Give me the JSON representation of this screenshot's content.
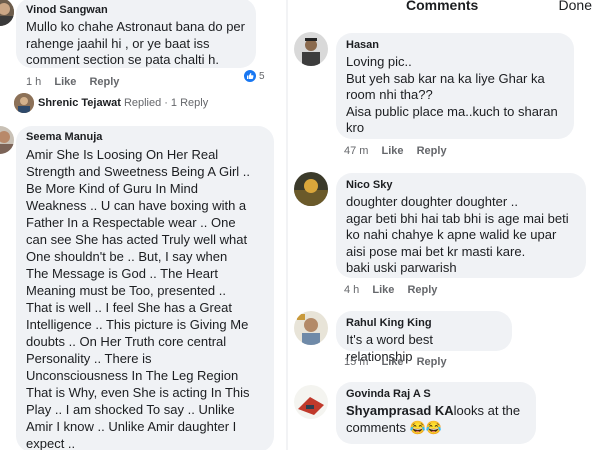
{
  "left": {
    "comments": [
      {
        "author": "Vinod Sangwan",
        "text": "Mullo ko chahe Astronaut bana do per\nrahenge jaahil hi , or ye baat iss\ncomment section se pata chalti h.",
        "time": "1 h",
        "like_label": "Like",
        "reply_label": "Reply",
        "reaction_count": "5",
        "reaction_icon": "like-icon"
      },
      {
        "author": "Seema Manuja",
        "text": "Amir She Is Loosing On Her Real\nStrength and Sweetness Being A Girl ..\nBe More Kind of Guru In Mind\nWeakness .. U can have boxing with a\nFather In a Respectable wear .. One\ncan see She has acted Truly well what\nOne shouldn't be .. But, I say when\nThe Message is God .. The Heart\nMeaning must be Too, presented ..\nThat is well .. I feel She has a Great\nIntelligence .. This picture is Giving Me\ndoubts .. On Her Truth core central\nPersonality .. There is\nUnconsciousness In The Leg Region\nThat is Why, even She is acting In This\nPlay .. I am shocked To say .. Unlike\nAmir I know .. Unlike Amir daughter I\nexpect .."
      }
    ],
    "reply_summary": {
      "name": "Shrenic Tejawat",
      "replied_label": "Replied",
      "separator": "·",
      "count_label": "1 Reply"
    }
  },
  "right": {
    "header": {
      "title": "Comments",
      "done_label": "Done"
    },
    "comments": [
      {
        "author": "Hasan",
        "text": "Loving pic..\nBut yeh sab kar na ka liye Ghar ka\nroom nhi tha??\nAisa public place ma..kuch to sharan\nkro",
        "time": "47 m",
        "like_label": "Like",
        "reply_label": "Reply"
      },
      {
        "author": "Nico Sky",
        "text": "doughter doughter doughter ..\nagar beti bhi hai tab bhi is age mai beti\nko nahi chahye k apne walid ke upar\naisi pose mai bet kr masti kare.\nbaki uski parwarish",
        "time": "4 h",
        "like_label": "Like",
        "reply_label": "Reply"
      },
      {
        "author": "Rahul King King",
        "text": "It's a word best relationship",
        "time": "15 m",
        "like_label": "Like",
        "reply_label": "Reply"
      },
      {
        "author": "Govinda Raj A S",
        "mention": "Shyamprasad KA",
        "text": "looks at the\ncomments",
        "emoji": "😂😂"
      }
    ]
  },
  "colors": {
    "bubble": "#f0f2f5",
    "meta": "#65676b",
    "accent": "#1877f2"
  }
}
